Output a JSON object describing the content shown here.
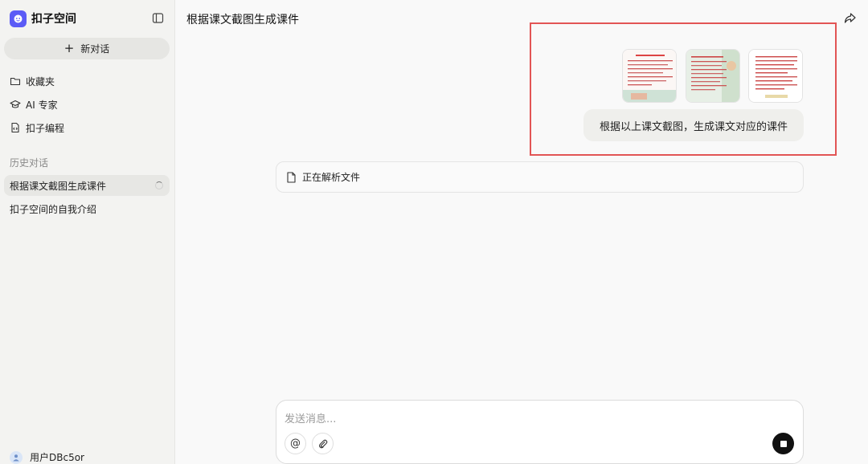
{
  "brand": {
    "name": "扣子空间"
  },
  "sidebar": {
    "new_chat_label": "新对话",
    "nav": [
      {
        "label": "收藏夹",
        "icon": "folder-icon"
      },
      {
        "label": "AI 专家",
        "icon": "graduation-cap-icon"
      },
      {
        "label": "扣子编程",
        "icon": "code-file-icon"
      }
    ],
    "history_label": "历史对话",
    "history": [
      {
        "label": "根据课文截图生成课件",
        "active": true
      },
      {
        "label": "扣子空间的自我介绍",
        "active": false
      }
    ],
    "user_name": "用户DBc5or"
  },
  "main": {
    "title": "根据课文截图生成课件",
    "user_message": "根据以上课文截图，生成课文对应的课件",
    "attachments_count": 3,
    "file_status": "正在解析文件",
    "composer_placeholder": "发送消息...",
    "highlight_color": "#e25555"
  }
}
